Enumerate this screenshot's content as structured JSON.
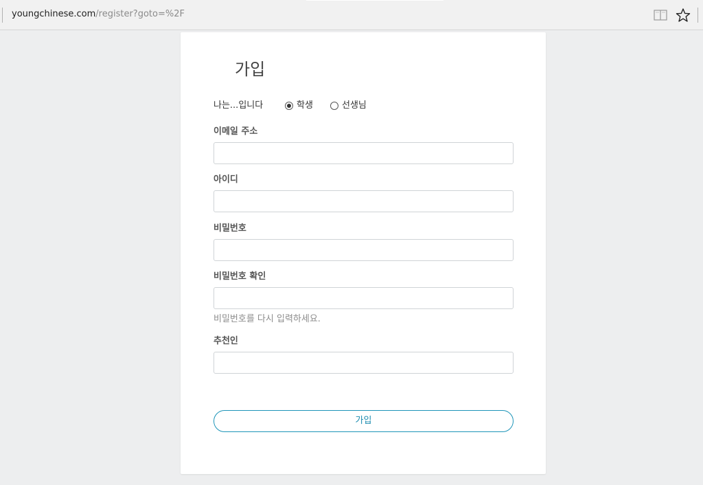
{
  "browser": {
    "url_host": "youngchinese.com",
    "url_path": "/register?goto=%2F",
    "icons": [
      "reading-view-icon",
      "favorite-star-icon"
    ]
  },
  "form": {
    "title": "가입",
    "role_label": "나는...입니다",
    "role_options": [
      {
        "label": "학생",
        "checked": true
      },
      {
        "label": "선생님",
        "checked": false
      }
    ],
    "fields": {
      "email": {
        "label": "이메일 주소",
        "value": ""
      },
      "username": {
        "label": "아이디",
        "value": ""
      },
      "password": {
        "label": "비밀번호",
        "value": ""
      },
      "password_confirm": {
        "label": "비밀번호 확인",
        "value": "",
        "help": "비밀번호를 다시 입력하세요."
      },
      "referrer": {
        "label": "추천인",
        "value": ""
      }
    },
    "submit_label": "가입"
  },
  "colors": {
    "page_background": "#edeeef",
    "accent": "#1c94b8",
    "input_border": "#cfd3d6"
  }
}
